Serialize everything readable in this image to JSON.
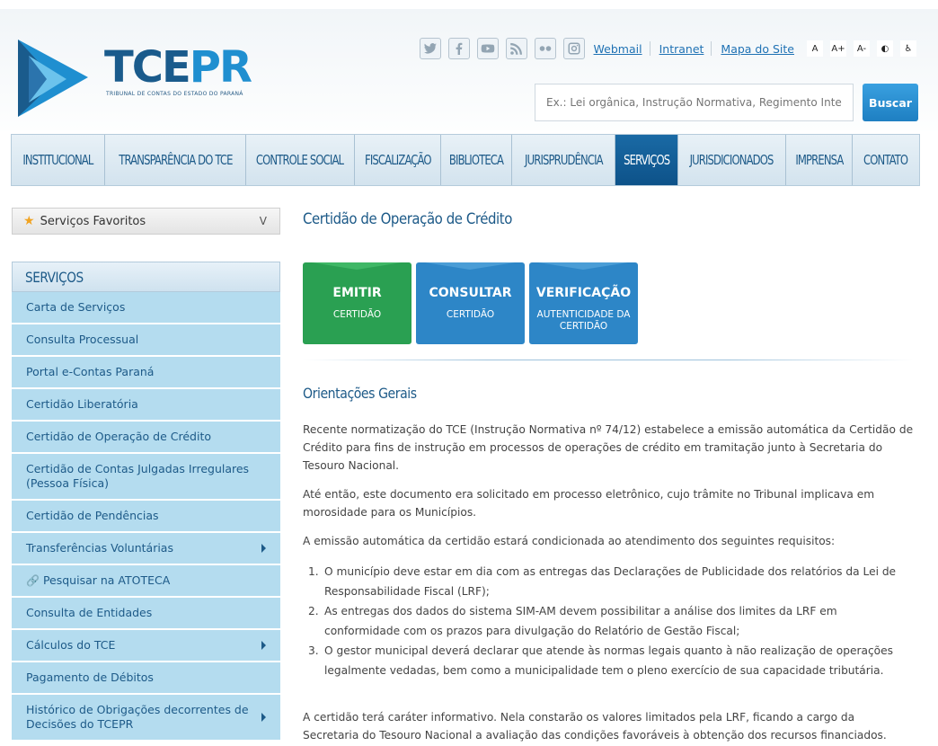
{
  "header": {
    "logo_main": "TCE",
    "logo_accent": "PR",
    "logo_sub": "TRIBUNAL DE CONTAS DO ESTADO DO PARANÁ",
    "social": [
      "twitter-icon",
      "facebook-icon",
      "youtube-icon",
      "rss-icon",
      "flickr-icon",
      "instagram-icon"
    ],
    "links": [
      "Webmail",
      "Intranet",
      "Mapa do Site"
    ],
    "accessibility": [
      "A",
      "A+",
      "A-",
      "◐",
      "♿"
    ],
    "search_placeholder": "Ex.: Lei orgânica, Instrução Normativa, Regimento Interno",
    "search_button": "Buscar"
  },
  "nav": {
    "items": [
      "INSTITUCIONAL",
      "TRANSPARÊNCIA DO TCE",
      "CONTROLE SOCIAL",
      "FISCALIZAÇÃO",
      "BIBLIOTECA",
      "JURISPRUDÊNCIA",
      "SERVIÇOS",
      "JURISDICIONADOS",
      "IMPRENSA",
      "CONTATO"
    ],
    "active": "SERVIÇOS"
  },
  "sidebar": {
    "favorites_label": "Serviços Favoritos",
    "favorites_chevron": "V",
    "title": "SERVIÇOS",
    "items": [
      {
        "label": "Carta de Serviços"
      },
      {
        "label": "Consulta Processual"
      },
      {
        "label": "Portal e-Contas Paraná"
      },
      {
        "label": "Certidão Liberatória"
      },
      {
        "label": "Certidão de Operação de Crédito"
      },
      {
        "label": "Certidão de Contas Julgadas Irregulares (Pessoa Física)"
      },
      {
        "label": "Certidão de Pendências"
      },
      {
        "label": "Transferências Voluntárias"
      },
      {
        "label": "Pesquisar na ATOTECA"
      },
      {
        "label": "Consulta de Entidades"
      },
      {
        "label": "Cálculos do TCE"
      },
      {
        "label": "Pagamento de Débitos"
      },
      {
        "label": "Histórico de Obrigações decorrentes de Decisões do TCEPR"
      }
    ]
  },
  "main": {
    "title": "Certidão de Operação de Crédito",
    "cards": [
      {
        "big": "EMITIR",
        "small": "CERTIDÃO"
      },
      {
        "big": "CONSULTAR",
        "small": "CERTIDÃO"
      },
      {
        "big": "VERIFICAÇÃO",
        "small": "AUTENTICIDADE DA CERTIDÃO"
      }
    ],
    "section_title": "Orientações Gerais",
    "p1": "Recente normatização do TCE (Instrução Normativa nº 74/12) estabelece a emissão automática da Certidão de Crédito para fins de instrução em processos de operações de crédito em tramitação junto à Secretaria do Tesouro Nacional.",
    "p2": "Até então, este documento era solicitado em processo eletrônico, cujo trâmite no Tribunal implicava em morosidade para os Municípios.",
    "p3": "A emissão automática da certidão estará condicionada ao atendimento dos seguintes requisitos:",
    "requirements": [
      "O município deve estar em dia com as entregas das Declarações de Publicidade dos relatórios da Lei de Responsabilidade Fiscal (LRF);",
      "As entregas dos dados do sistema SIM-AM devem possibilitar a análise dos limites da LRF em conformidade com os prazos para divulgação do Relatório de Gestão Fiscal;",
      "O gestor municipal deverá declarar que atende às normas legais quanto à não realização de operações legalmente vedadas, bem como a municipalidade tem o pleno exercício de sua capacidade tributária."
    ],
    "p4": "A certidão terá caráter informativo. Nela constarão os valores limitados pela LRF, ficando a cargo da Secretaria do Tesouro Nacional a avaliação das condições favoráveis à obtenção dos recursos financiados."
  }
}
